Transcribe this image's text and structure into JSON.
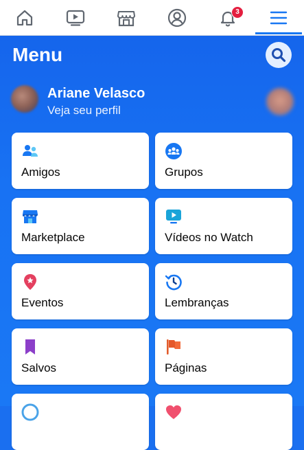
{
  "nav": {
    "items": [
      {
        "icon": "home-icon"
      },
      {
        "icon": "watch-icon"
      },
      {
        "icon": "marketplace-icon"
      },
      {
        "icon": "profile-icon"
      },
      {
        "icon": "bell-icon",
        "badge": "3"
      },
      {
        "icon": "menu-icon",
        "active": true
      }
    ]
  },
  "menu": {
    "title": "Menu",
    "profile": {
      "name": "Ariane Velasco",
      "subtitle": "Veja seu perfil"
    },
    "tiles": [
      {
        "label": "Amigos",
        "icon": "friends-icon"
      },
      {
        "label": "Grupos",
        "icon": "groups-icon"
      },
      {
        "label": "Marketplace",
        "icon": "marketplace-shop-icon"
      },
      {
        "label": "Vídeos no Watch",
        "icon": "watch-video-icon"
      },
      {
        "label": "Eventos",
        "icon": "events-icon"
      },
      {
        "label": "Lembranças",
        "icon": "memories-icon"
      },
      {
        "label": "Salvos",
        "icon": "saved-bookmark-icon"
      },
      {
        "label": "Páginas",
        "icon": "pages-flag-icon"
      }
    ]
  },
  "colors": {
    "brand": "#1877f2",
    "panel": "#1a6ff0",
    "badge": "#e41e3f"
  }
}
